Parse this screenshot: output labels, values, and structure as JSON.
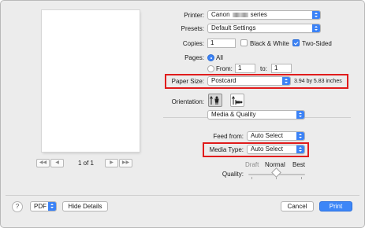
{
  "printer": {
    "label": "Printer:",
    "name_prefix": "Canon",
    "name_suffix": "series"
  },
  "presets": {
    "label": "Presets:",
    "value": "Default Settings"
  },
  "copies": {
    "label": "Copies:",
    "value": "1",
    "bw_label": "Black & White",
    "bw_checked": false,
    "two_sided_label": "Two-Sided",
    "two_sided_checked": true
  },
  "pages": {
    "label": "Pages:",
    "all_label": "All",
    "from_label": "From:",
    "from_value": "1",
    "to_label": "to:",
    "to_value": "1",
    "selected": "All"
  },
  "paper_size": {
    "label": "Paper Size:",
    "value": "Postcard",
    "dimensions": "3.94 by 5.83 inches"
  },
  "orientation": {
    "label": "Orientation:",
    "selected": "portrait"
  },
  "section": {
    "value": "Media & Quality"
  },
  "feed_from": {
    "label": "Feed from:",
    "value": "Auto Select"
  },
  "media_type": {
    "label": "Media Type:",
    "value": "Auto Select"
  },
  "quality": {
    "label": "Quality:",
    "draft": "Draft",
    "normal": "Normal",
    "best": "Best",
    "selected": "Normal"
  },
  "preview": {
    "page_count": "1 of 1"
  },
  "footer": {
    "help": "?",
    "pdf": "PDF",
    "hide_details": "Hide Details",
    "cancel": "Cancel",
    "print": "Print"
  },
  "colors": {
    "accent": "#3b82f6",
    "highlight": "#e01c1c"
  },
  "icons": {
    "nav": [
      "first-page-icon",
      "previous-page-icon",
      "next-page-icon",
      "last-page-icon"
    ],
    "orientation": [
      "portrait-icon",
      "landscape-icon"
    ],
    "popup": "popup-arrows-icon",
    "help": "question-mark-icon"
  }
}
